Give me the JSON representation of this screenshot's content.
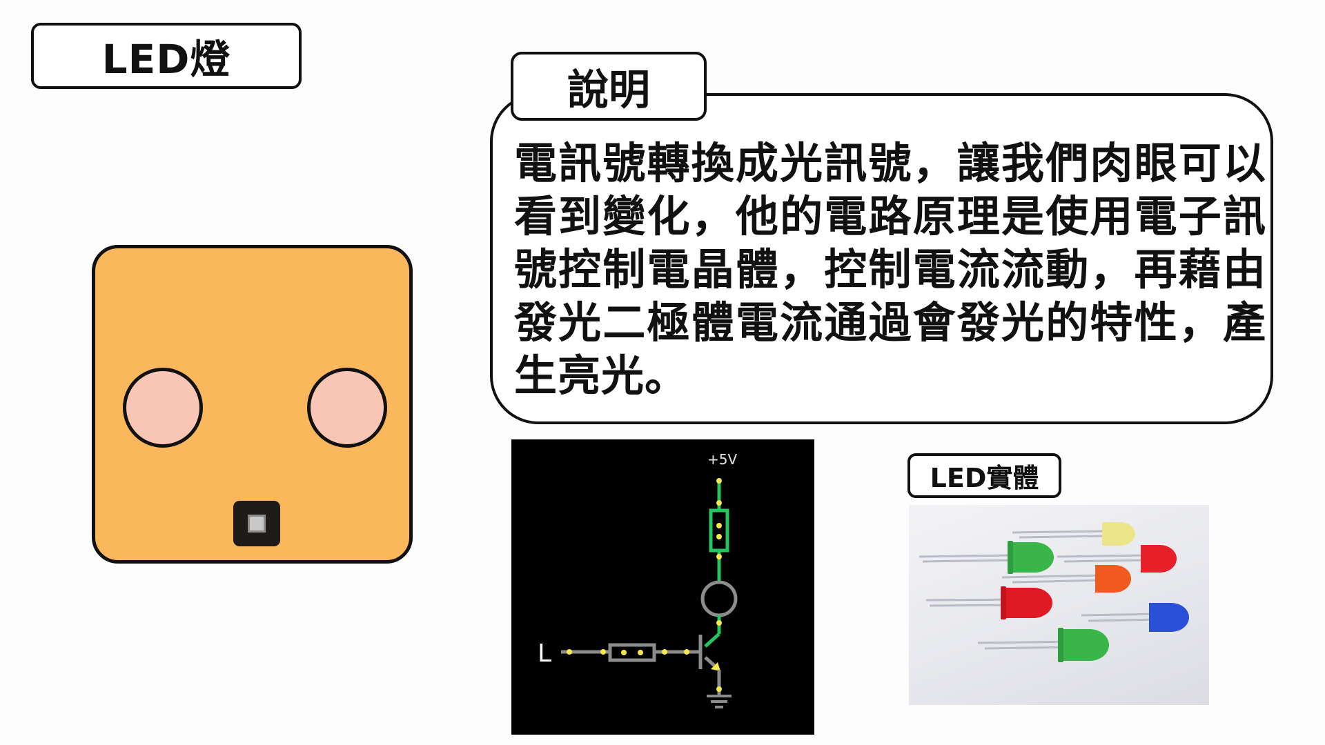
{
  "header": {
    "title": "LED燈"
  },
  "description": {
    "tab_label": "說明",
    "text": "電訊號轉換成光訊號，讓我們肉眼可以看到變化，他的電路原理是使用電子訊號控制電晶體，控制電流流動，再藉由發光二極體電流通過會發光的特性，產生亮光。"
  },
  "module": {
    "name": "LED module illustration",
    "body_color": "#fbb75c",
    "hole_color": "#f9c6b5"
  },
  "circuit": {
    "supply_label": "+5V",
    "input_label": "L",
    "wire_color": "#22c55e",
    "node_color": "#f5e84a"
  },
  "photo": {
    "tab_label": "LED實體",
    "led_colors": [
      "#3ab54a",
      "#e8e27a",
      "#e8202a",
      "#f05a1e",
      "#2a4fd8"
    ]
  }
}
